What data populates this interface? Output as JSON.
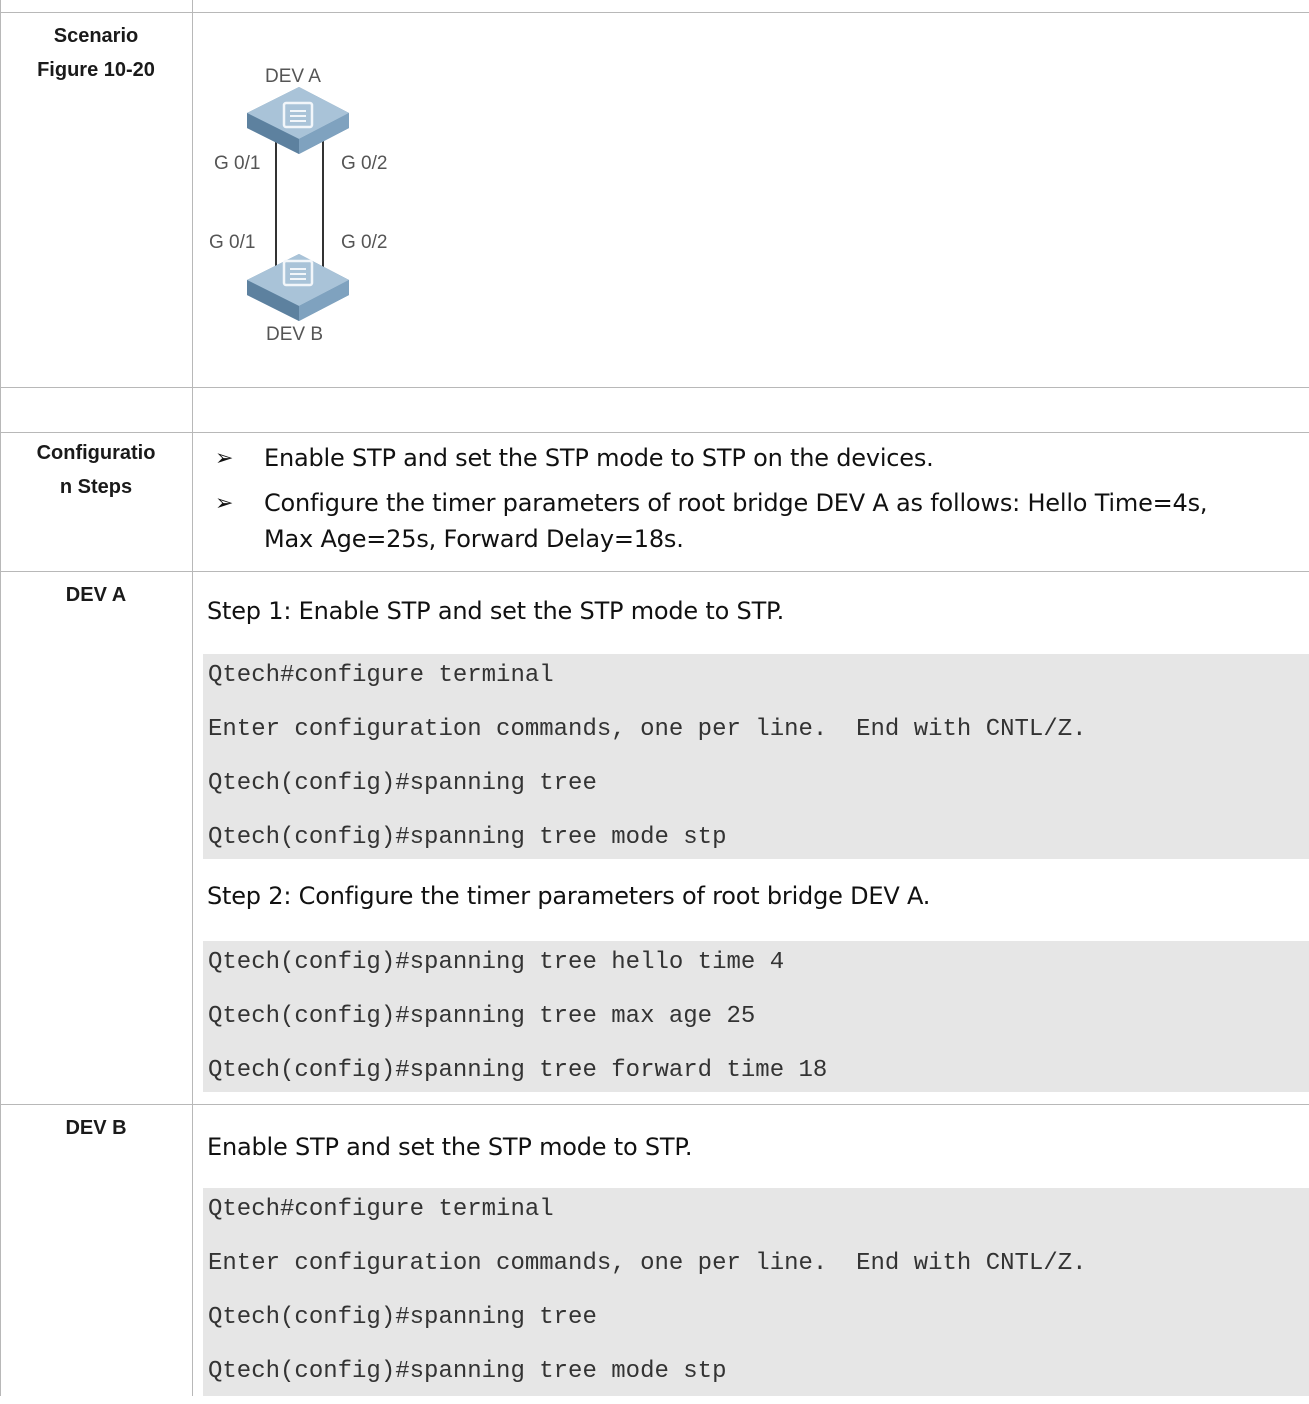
{
  "scenario": {
    "label_line1": "Scenario",
    "label_line2": "Figure 10-20",
    "figure": {
      "dev_a": "DEV A",
      "dev_b": "DEV B",
      "a_port_left": "G 0/1",
      "a_port_right": "G 0/2",
      "b_port_left": "G 0/1",
      "b_port_right": "G 0/2"
    }
  },
  "config_steps": {
    "label_line1": "Configuratio",
    "label_line2": "n Steps",
    "bullet_symbol": "➢",
    "items": [
      "Enable STP and set the STP mode to STP on the devices.",
      "Configure the timer parameters of root bridge DEV A as follows: Hello Time=4s,",
      "Max Age=25s, Forward Delay=18s."
    ]
  },
  "dev_a": {
    "label": "DEV A",
    "step1_title": "Step 1: Enable STP and set the STP mode to STP.",
    "step1_code": [
      "Qtech#configure terminal",
      "Enter configuration commands, one per line.  End with CNTL/Z.",
      "Qtech(config)#spanning tree",
      "Qtech(config)#spanning tree mode stp"
    ],
    "step2_title": "Step 2: Configure the timer parameters of root bridge DEV A.",
    "step2_code": [
      "Qtech(config)#spanning tree hello time 4",
      "Qtech(config)#spanning tree max age 25",
      "Qtech(config)#spanning tree forward time 18"
    ]
  },
  "dev_b": {
    "label": "DEV B",
    "title": "Enable STP and set the STP mode to STP.",
    "code": [
      "Qtech#configure terminal",
      "Enter configuration commands, one per line.  End with CNTL/Z.",
      "Qtech(config)#spanning tree",
      "Qtech(config)#spanning tree mode stp"
    ]
  }
}
